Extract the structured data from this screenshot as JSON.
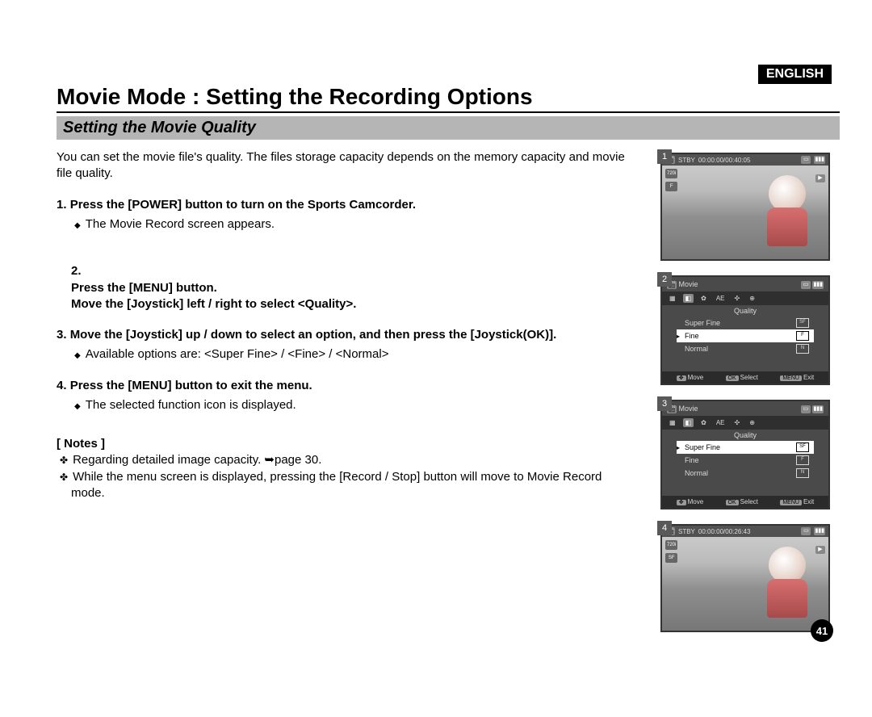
{
  "language_badge": "ENGLISH",
  "main_title": "Movie Mode : Setting the Recording Options",
  "section_title": "Setting the Movie Quality",
  "intro": "You can set the movie file's quality. The files storage capacity depends on the memory capacity and movie file quality.",
  "steps": [
    {
      "num": "1.",
      "title": "Press the [POWER] button to turn on the Sports Camcorder.",
      "subs": [
        "The Movie Record screen appears."
      ]
    },
    {
      "num": "2.",
      "title": "Press the [MENU] button.\nMove the [Joystick] left / right to select <Quality>.",
      "subs": []
    },
    {
      "num": "3.",
      "title": "Move the [Joystick] up / down to select an option, and then press the [Joystick(OK)].",
      "subs": [
        "Available options are: <Super Fine> / <Fine> / <Normal>"
      ]
    },
    {
      "num": "4.",
      "title": "Press the [MENU] button to exit the menu.",
      "subs": [
        "The selected function icon is displayed."
      ]
    }
  ],
  "notes_label": "[ Notes ]",
  "notes": [
    "Regarding detailed image capacity. ➥page 30.",
    "While the menu screen is displayed, pressing the [Record / Stop] button will move to Movie Record mode."
  ],
  "shots": {
    "s1": {
      "num": "1",
      "status": "STBY",
      "time": "00:00:00/00:40:05",
      "res": "720i",
      "qlabel": "F"
    },
    "s2": {
      "num": "2",
      "mode": "Movie",
      "heading": "Quality",
      "items": [
        {
          "label": "Super Fine",
          "icon": "SF",
          "selected": false,
          "arrow": false
        },
        {
          "label": "Fine",
          "icon": "F",
          "selected": true,
          "arrow": true
        },
        {
          "label": "Normal",
          "icon": "N",
          "selected": false,
          "arrow": false
        }
      ],
      "bottom": {
        "move": "Move",
        "select": "Select",
        "exit": "Exit"
      }
    },
    "s3": {
      "num": "3",
      "mode": "Movie",
      "heading": "Quality",
      "items": [
        {
          "label": "Super Fine",
          "icon": "SF",
          "selected": true,
          "arrow": true
        },
        {
          "label": "Fine",
          "icon": "F",
          "selected": false,
          "arrow": false
        },
        {
          "label": "Normal",
          "icon": "N",
          "selected": false,
          "arrow": false
        }
      ],
      "bottom": {
        "move": "Move",
        "select": "Select",
        "exit": "Exit"
      }
    },
    "s4": {
      "num": "4",
      "status": "STBY",
      "time": "00:00:00/00:26:43",
      "res": "720i",
      "qlabel": "SF"
    }
  },
  "page_number": "41"
}
